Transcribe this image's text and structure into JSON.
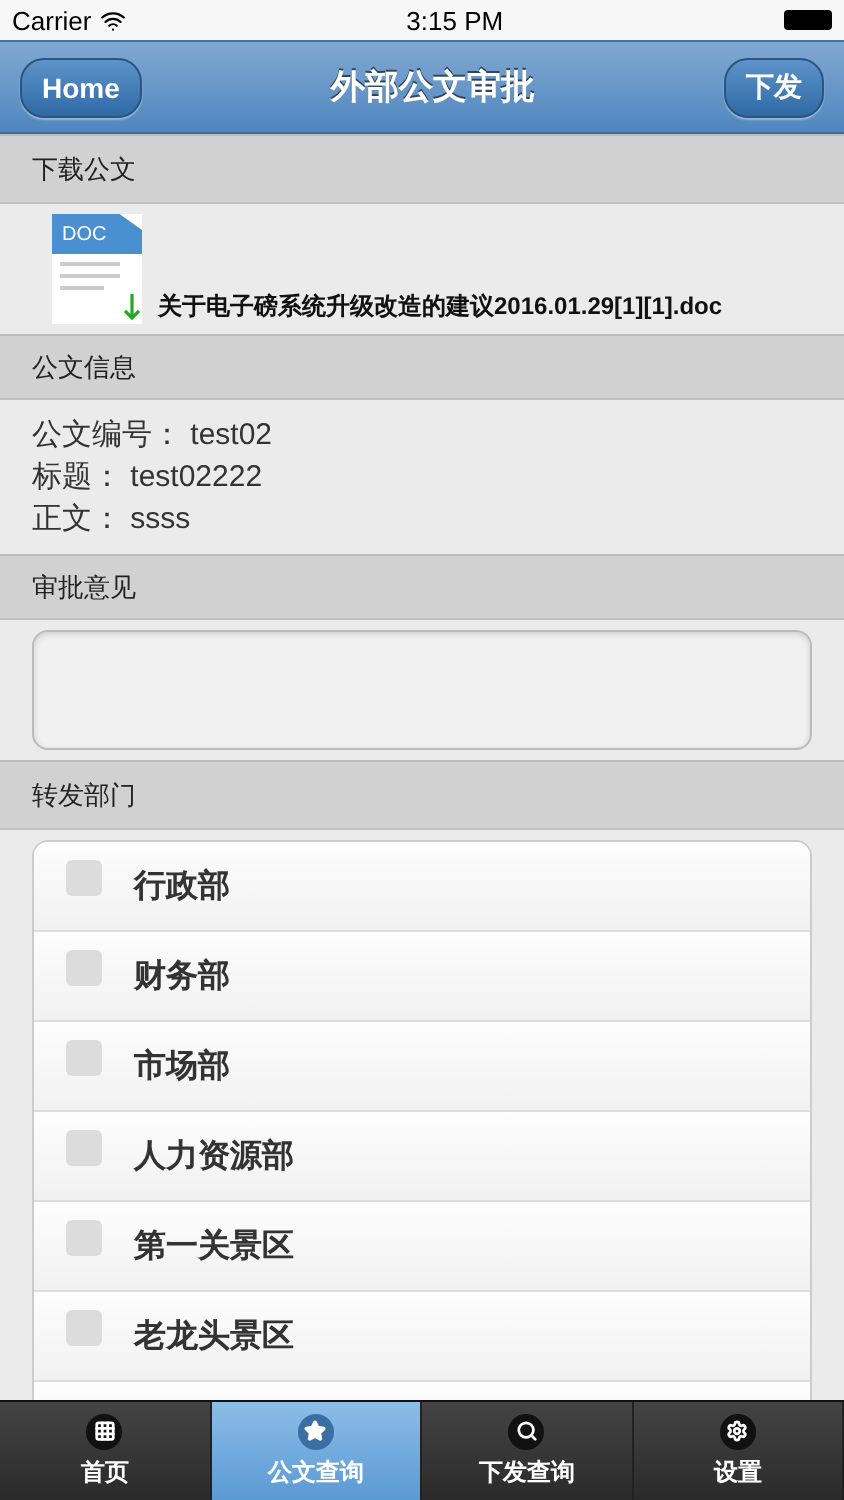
{
  "status_bar": {
    "carrier": "Carrier",
    "time": "3:15 PM"
  },
  "header": {
    "left_button": "Home",
    "title": "外部公文审批",
    "right_button": "下发"
  },
  "download": {
    "heading": "下载公文",
    "file_badge": "DOC",
    "file_name": "关于电子磅系统升级改造的建议2016.01.29[1][1].doc"
  },
  "info": {
    "heading": "公文信息",
    "lines": [
      {
        "label": "公文编号：",
        "value": "test02"
      },
      {
        "label": "标题：",
        "value": "test02222"
      },
      {
        "label": "正文：",
        "value": "ssss"
      }
    ]
  },
  "opinion": {
    "heading": "审批意见"
  },
  "departments": {
    "heading": "转发部门",
    "items": [
      {
        "label": "行政部",
        "checked": false
      },
      {
        "label": "财务部",
        "checked": false
      },
      {
        "label": "市场部",
        "checked": false
      },
      {
        "label": "人力资源部",
        "checked": false
      },
      {
        "label": "第一关景区",
        "checked": false
      },
      {
        "label": "老龙头景区",
        "checked": false
      }
    ]
  },
  "tab_bar": [
    {
      "kind": "grid",
      "label": "首页",
      "selected": false
    },
    {
      "kind": "star",
      "label": "公文查询",
      "selected": true
    },
    {
      "kind": "search",
      "label": "下发查询",
      "selected": false
    },
    {
      "kind": "gear",
      "label": "设置",
      "selected": false
    }
  ]
}
